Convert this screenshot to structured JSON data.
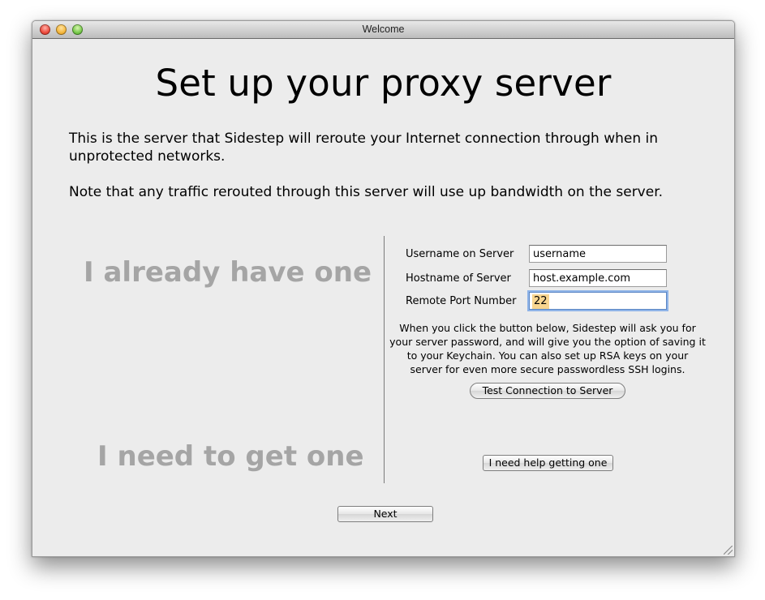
{
  "window": {
    "title": "Welcome"
  },
  "page": {
    "title": "Set up your proxy server",
    "intro_paragraph_1": "This is the server that Sidestep will reroute your Internet connection through when in unprotected networks.",
    "intro_paragraph_2": "Note that any traffic rerouted through this server will use up bandwidth on the server."
  },
  "sections": {
    "have_one_heading": "I already have one",
    "need_one_heading": "I need to get one"
  },
  "form": {
    "username_label": "Username on Server",
    "username_value": "username",
    "hostname_label": "Hostname of Server",
    "hostname_value": "host.example.com",
    "port_label": "Remote Port Number",
    "port_value": "22",
    "info_text": "When you click the button below, Sidestep will ask you for your server password, and will give you the option of saving it to your Keychain. You can also set up RSA keys on your server for even more secure passwordless SSH logins."
  },
  "buttons": {
    "test_connection": "Test Connection to Server",
    "need_help": "I need help getting one",
    "next": "Next"
  },
  "colors": {
    "window_bg": "#ececec",
    "heading_gray": "#a5a5a5",
    "focus_ring": "#8fb4e8",
    "selection": "#f8d58f"
  }
}
